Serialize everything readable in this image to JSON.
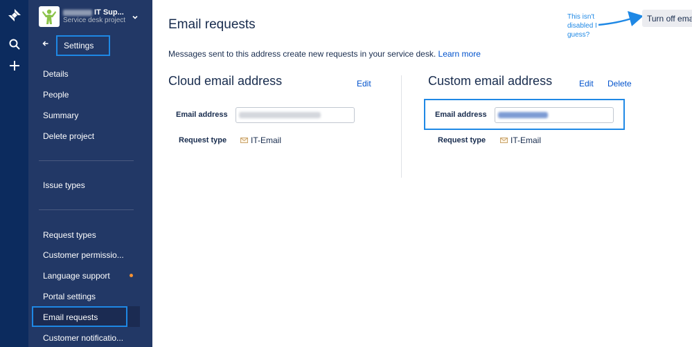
{
  "global_nav": {
    "icons": [
      "jira-logo-icon",
      "search-icon",
      "plus-icon"
    ]
  },
  "project": {
    "name": "IT Sup...",
    "type": "Service desk project"
  },
  "sidebar": {
    "back_label": "Settings",
    "items": [
      {
        "label": "Details"
      },
      {
        "label": "People"
      },
      {
        "label": "Summary"
      },
      {
        "label": "Delete project"
      },
      {
        "label": "Issue types"
      },
      {
        "label": "Request types"
      },
      {
        "label": "Customer permissio..."
      },
      {
        "label": "Language support"
      },
      {
        "label": "Portal settings"
      },
      {
        "label": "Email requests"
      },
      {
        "label": "Customer notificatio..."
      }
    ],
    "selected": "Email requests",
    "colors": {
      "background": "#223866",
      "nav": "#0c2b5e",
      "highlight": "#1e88e5",
      "dot": "#f79232"
    }
  },
  "main": {
    "title": "Email requests",
    "intro_text": "Messages sent to this address create new requests in your service desk.",
    "learn_more": "Learn more",
    "cloud": {
      "title": "Cloud email address",
      "edit": "Edit",
      "email_label": "Email address",
      "request_type_label": "Request type",
      "request_type_value": "IT-Email"
    },
    "custom": {
      "title": "Custom email address",
      "edit": "Edit",
      "delete": "Delete",
      "email_label": "Email address",
      "request_type_label": "Request type",
      "request_type_value": "IT-Email"
    }
  },
  "annotation": {
    "lines": [
      "This isn't",
      "disabled I",
      "guess?"
    ],
    "button": "Turn off email"
  }
}
